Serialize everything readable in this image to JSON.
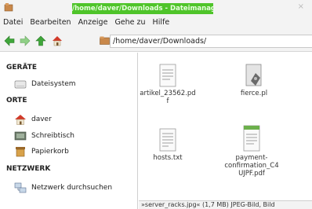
{
  "window": {
    "title": "/home/daver/Downloads - Dateimanager",
    "close_glyph": "×",
    "title_color": "#4fc42a"
  },
  "menu": {
    "items": [
      "Datei",
      "Bearbeiten",
      "Anzeige",
      "Gehe zu",
      "Hilfe"
    ]
  },
  "toolbar": {
    "back_icon": "arrow-left-icon",
    "forward_icon": "arrow-right-icon",
    "up_icon": "arrow-up-icon",
    "home_icon": "home-icon",
    "path": "/home/daver/Downloads/"
  },
  "sidebar": {
    "sections": [
      {
        "title": "GERÄTE",
        "items": [
          {
            "label": "Dateisystem",
            "icon": "drive-icon"
          }
        ]
      },
      {
        "title": "ORTE",
        "items": [
          {
            "label": "daver",
            "icon": "home-icon"
          },
          {
            "label": "Schreibtisch",
            "icon": "desktop-icon"
          },
          {
            "label": "Papierkorb",
            "icon": "trash-icon"
          }
        ]
      },
      {
        "title": "NETZWERK",
        "items": [
          {
            "label": "Netzwerk durchsuchen",
            "icon": "network-icon"
          }
        ]
      }
    ]
  },
  "files": [
    {
      "name": "artikel_23562.pdf",
      "icon": "document-icon"
    },
    {
      "name": "fierce.pl",
      "icon": "script-icon"
    },
    {
      "name": "hosts.txt",
      "icon": "text-file-icon"
    },
    {
      "name": "payment-confirmation_C4UJPF.pdf",
      "icon": "document-icon"
    }
  ],
  "status": {
    "text": "»server_racks.jpg« (1,7 MB) JPEG-Bild, Bild"
  }
}
